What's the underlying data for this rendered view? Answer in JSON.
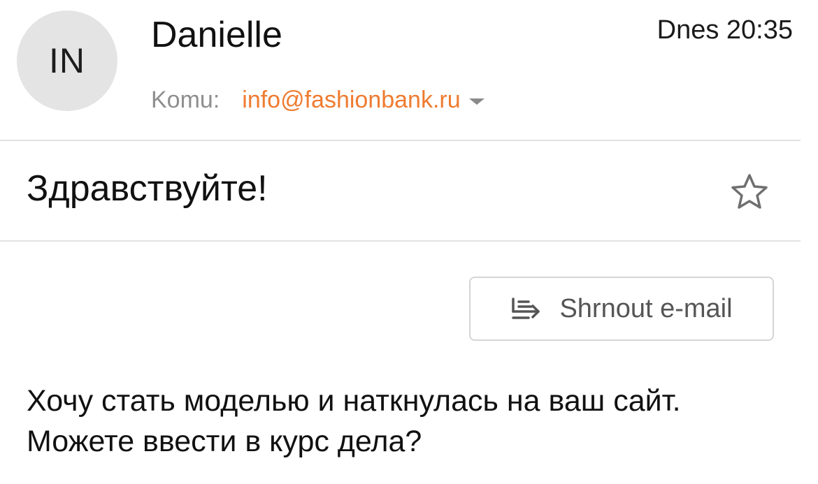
{
  "message": {
    "avatar_initials": "IN",
    "sender_name": "Danielle",
    "date": "Dnes 20:35",
    "to_label": "Komu:",
    "to_address": "info@fashionbank.ru",
    "subject": "Здравствуйте!",
    "share_button_label": "Shrnout e-mail",
    "body": "Хочу стать моделью и наткнулась на ваш сайт. Можете ввести в курс дела?"
  },
  "colors": {
    "accent": "#ef7b30",
    "avatar_bg": "#e4e4e4",
    "divider": "#e2e2e2",
    "muted_text": "#8e8e8e"
  },
  "icons": {
    "star": "star-outline-icon",
    "share": "summarize-lines-icon",
    "recipient_dropdown": "chevron-down-icon"
  }
}
